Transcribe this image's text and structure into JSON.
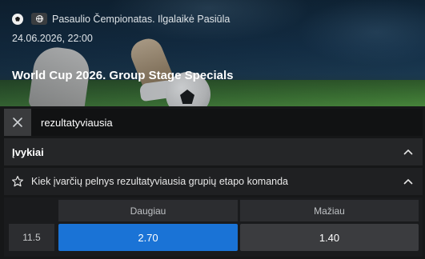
{
  "event": {
    "competition": "Pasaulio Čempionatas. Ilgalaikė Pasiūla",
    "datetime": "24.06.2026, 22:00",
    "title": "World Cup 2026. Group Stage Specials",
    "sport_icon": "soccer-ball-icon",
    "region_icon": "globe-icon"
  },
  "search": {
    "value": "rezultatyviausia",
    "clear_icon": "close-icon"
  },
  "section": {
    "label": "Įvykiai",
    "expanded": true
  },
  "market": {
    "name": "Kiek įvarčių pelnys rezultatyviausia grupių etapo komanda",
    "favorite_icon": "star-icon",
    "columns": [
      "Daugiau",
      "Mažiau"
    ],
    "rows": [
      {
        "line": "11.5",
        "over": "2.70",
        "under": "1.40",
        "selected": "over"
      }
    ]
  },
  "colors": {
    "background": "#161718",
    "selected_odd": "#1a73d6",
    "odd": "#3b3c3f"
  }
}
